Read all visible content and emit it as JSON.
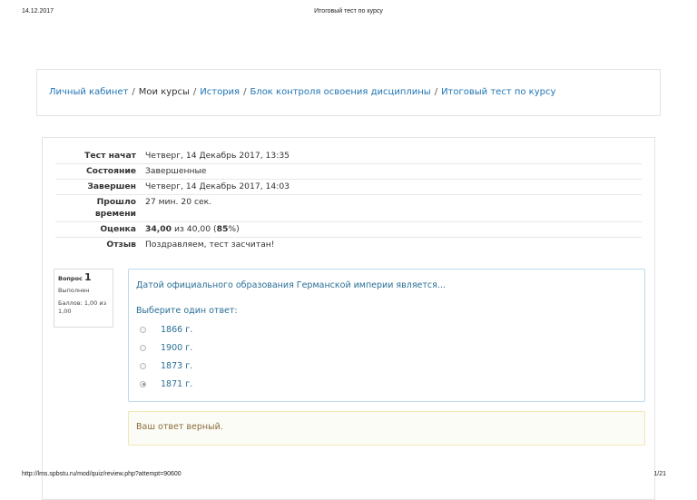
{
  "print_header": {
    "date": "14.12.2017",
    "title": "Итоговый тест по курсу"
  },
  "print_footer": {
    "url": "http://lms.spbstu.ru/mod/quiz/review.php?attempt=90600",
    "page": "1/21"
  },
  "breadcrumb": {
    "items": [
      {
        "label": "Личный кабинет",
        "link": true
      },
      {
        "label": "Мои курсы",
        "link": false
      },
      {
        "label": "История",
        "link": true
      },
      {
        "label": "Блок контроля освоения дисциплины",
        "link": true
      },
      {
        "label": "Итоговый тест по курсу",
        "link": true
      }
    ],
    "separator": "/"
  },
  "summary": {
    "rows": [
      {
        "label": "Тест начат",
        "value": "Четверг, 14 Декабрь 2017, 13:35"
      },
      {
        "label": "Состояние",
        "value": "Завершенные"
      },
      {
        "label": "Завершен",
        "value": "Четверг, 14 Декабрь 2017, 14:03"
      },
      {
        "label": "Прошло времени",
        "value": "27 мин. 20 сек."
      },
      {
        "label": "Оценка",
        "value_bold": "34,00",
        "value_mid": " из 40,00 (",
        "value_pct": "85",
        "value_end": "%)"
      },
      {
        "label": "Отзыв",
        "value": "Поздравляем, тест засчитан!"
      }
    ]
  },
  "question": {
    "label": "Вопрос",
    "number": "1",
    "state": "Выполнен",
    "grade": "Баллов: 1,00 из 1,00",
    "text": "Датой официального образования Германской империи является...",
    "prompt": "Выберите один ответ:",
    "answers": [
      {
        "label": "1866 г.",
        "checked": false
      },
      {
        "label": "1900 г.",
        "checked": false
      },
      {
        "label": "1873 г.",
        "checked": false
      },
      {
        "label": "1871 г.",
        "checked": true
      }
    ],
    "feedback": "Ваш ответ верный."
  }
}
